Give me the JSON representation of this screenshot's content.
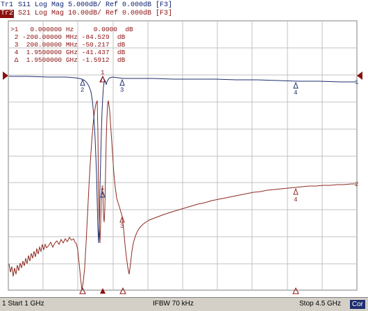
{
  "traces": {
    "tr1": {
      "tag": "Tr1",
      "text": " S11 Log Mag 5.000dB/ Ref 0.000dB [F3]",
      "color": "#0a1e6e"
    },
    "tr2": {
      "tag": "Tr2",
      "text": " S21 Log Mag 10.00dB/ Ref 0.000dB [F3]",
      "color": "#8b1010"
    }
  },
  "marker_table": [
    {
      "id": ">1",
      "value": "  0.000000 Hz     0.0000  dB"
    },
    {
      "id": " 2",
      "value": "-200.00000 MHz -84.529  dB"
    },
    {
      "id": " 3",
      "value": " 200.00000 MHz -50.217  dB"
    },
    {
      "id": " 4",
      "value": " 1.9500000 GHz -41.437  dB"
    },
    {
      "id": " Δ",
      "value": " 1.9500000 GHz -1.5912  dB"
    }
  ],
  "marker_labels": {
    "m1": "1",
    "m2": "2",
    "m3": "3",
    "m4": "4",
    "trace1_end": "1",
    "trace2_end": "2"
  },
  "status": {
    "start": "1  Start 1 GHz",
    "ifbw": "IFBW 70 kHz",
    "stop": "Stop 4.5 GHz",
    "cor": "Cor"
  },
  "colors": {
    "s11_trace": "#1d2e6e",
    "s21_trace": "#8b2a20",
    "grid": "#c0c0c0",
    "marker_active": "#8b1010"
  }
}
